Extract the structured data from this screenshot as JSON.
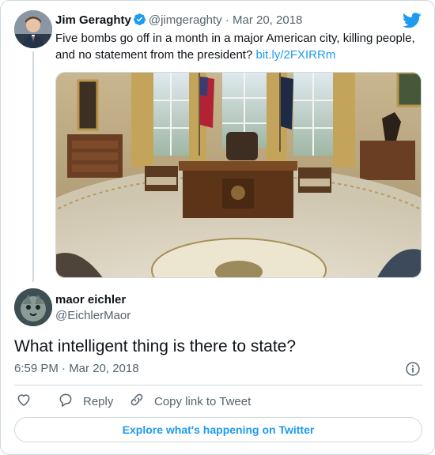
{
  "parent_tweet": {
    "author_name": "Jim Geraghty",
    "author_handle": "@jimgeraghty",
    "separator": "·",
    "date": "Mar 20, 2018",
    "text": "Five bombs go off in a month in a major American city, killing people, and no statement from the president?",
    "link": "bit.ly/2FXIRRm"
  },
  "reply_tweet": {
    "author_name": "maor eichler",
    "author_handle": "@EichlerMaor",
    "text": "What intelligent thing is there to state?",
    "timestamp": "6:59 PM · Mar 20, 2018"
  },
  "actions": {
    "reply_label": "Reply",
    "copy_label": "Copy link to Tweet"
  },
  "explore": {
    "label": "Explore what's happening on Twitter"
  },
  "icons": {
    "brand": "twitter-bird-icon",
    "verified": "verified-badge-icon",
    "info": "info-icon",
    "like": "heart-icon",
    "reply": "reply-bubble-icon",
    "copy": "link-icon"
  },
  "colors": {
    "accent": "#1d9bf0",
    "text_primary": "#0f1419",
    "text_secondary": "#536471",
    "border": "#cfd9de"
  }
}
